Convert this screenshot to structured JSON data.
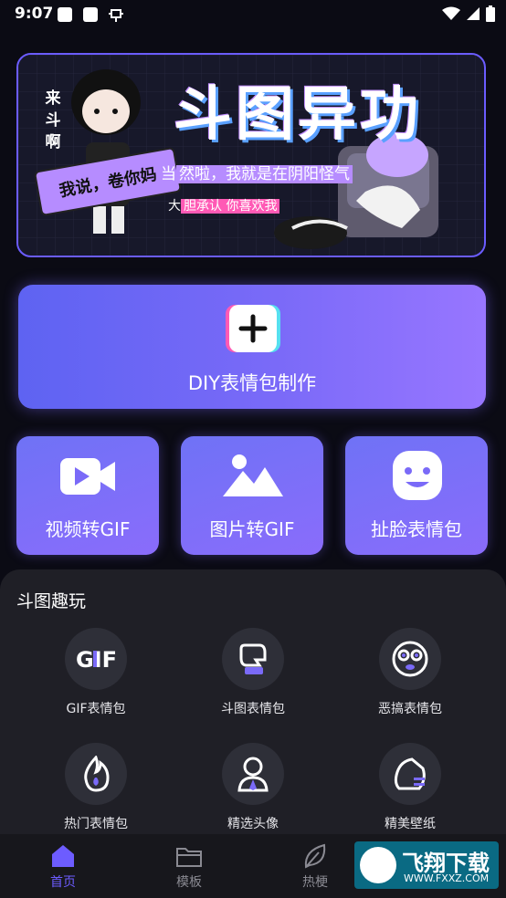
{
  "status_bar": {
    "time": "9:07"
  },
  "banner": {
    "title": "斗图异功",
    "side_text": "来斗啊",
    "ribbon_text": "我说，卷你妈",
    "line1_prefix": "当",
    "line1_highlight": "然啦，我就是在阴阳怪气",
    "line2_prefix": "大",
    "line2_highlight": "胆承认 你喜欢我"
  },
  "diy": {
    "label": "DIY表情包制作",
    "icon": "plus-icon"
  },
  "tools": [
    {
      "label": "视频转GIF",
      "icon": "video-camera-icon"
    },
    {
      "label": "图片转GIF",
      "icon": "image-mountain-icon"
    },
    {
      "label": "扯脸表情包",
      "icon": "smiley-face-icon"
    }
  ],
  "section": {
    "title": "斗图趣玩",
    "items": [
      {
        "label": "GIF表情包",
        "icon": "gif-icon"
      },
      {
        "label": "斗图表情包",
        "icon": "fist-icon"
      },
      {
        "label": "恶搞表情包",
        "icon": "silly-face-icon"
      },
      {
        "label": "热门表情包",
        "icon": "flame-icon"
      },
      {
        "label": "精选头像",
        "icon": "person-icon"
      },
      {
        "label": "精美壁纸",
        "icon": "wallpaper-icon"
      }
    ]
  },
  "nav": {
    "items": [
      {
        "label": "首页",
        "icon": "home-icon",
        "active": true
      },
      {
        "label": "模板",
        "icon": "folder-icon",
        "active": false
      },
      {
        "label": "热梗",
        "icon": "leaf-icon",
        "active": false
      }
    ]
  },
  "watermark": {
    "title": "飞翔下载",
    "url": "WWW.FXXZ.COM"
  },
  "colors": {
    "accent": "#6d5cff",
    "panel": "#1f1f26",
    "background": "#0b0b14"
  }
}
